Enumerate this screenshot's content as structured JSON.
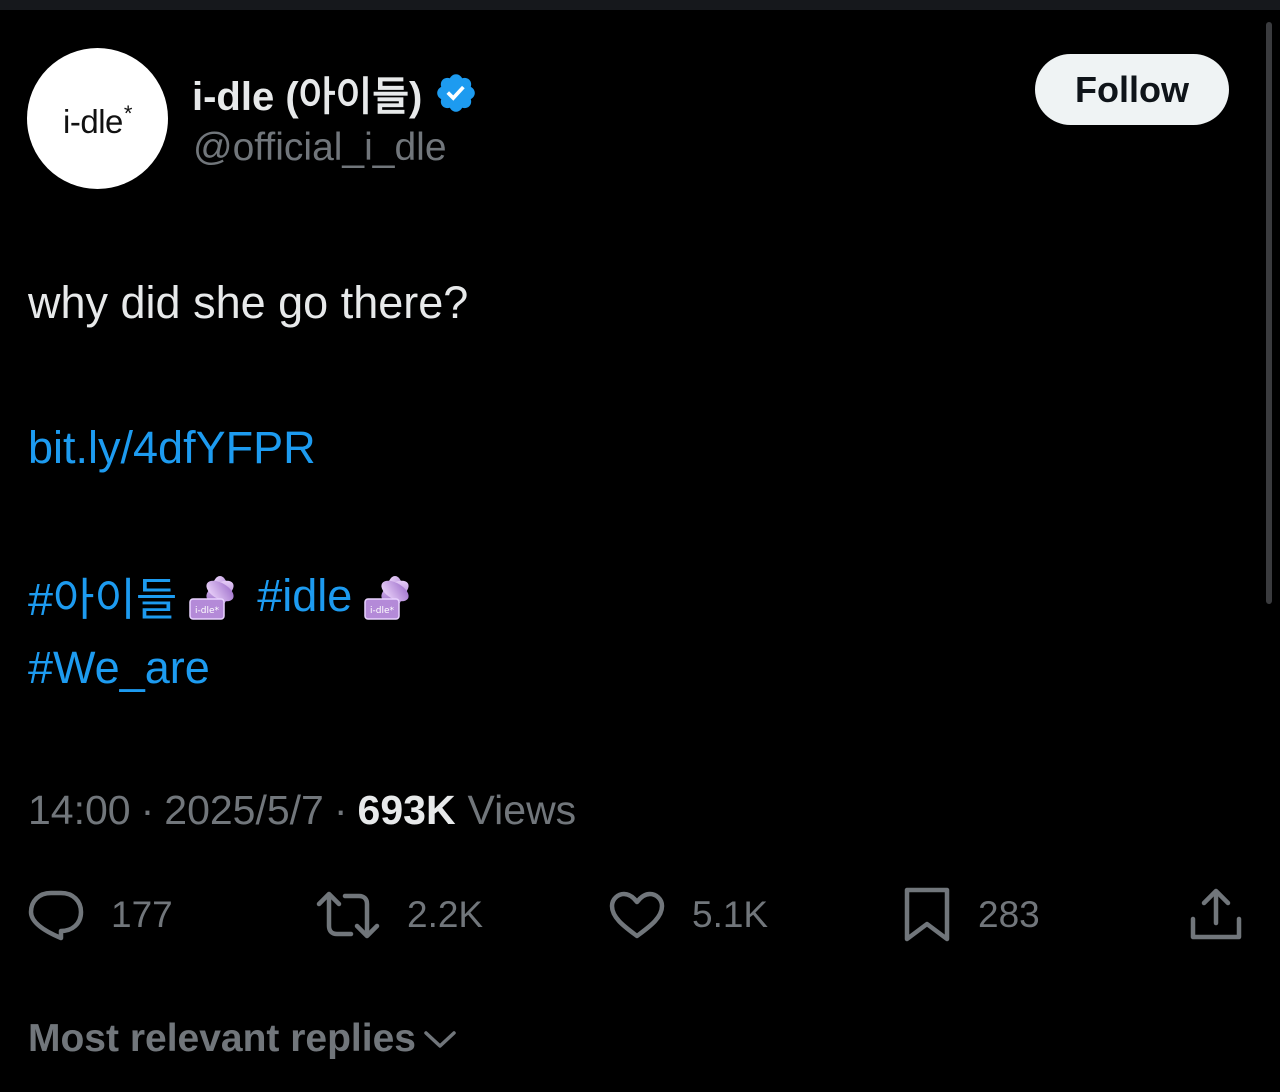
{
  "account": {
    "avatar_text": "i-dle",
    "avatar_mark": "*",
    "display_name": "i-dle (아이들)",
    "handle": "@official_i_dle",
    "verified_icon": "verified-badge-icon",
    "follow_label": "Follow"
  },
  "tweet": {
    "text": "why did she go there?",
    "link": "bit.ly/4dfYFPR",
    "hashtags": [
      "#아이들",
      "#idle",
      "#We_are"
    ],
    "emoji_icon": "idle-logo-emoji"
  },
  "meta": {
    "time": "14:00",
    "separator": "·",
    "date": "2025/5/7",
    "views_count": "693K",
    "views_label": "Views"
  },
  "actions": {
    "replies": "177",
    "retweets": "2.2K",
    "likes": "5.1K",
    "bookmarks": "283"
  },
  "replies_sort": {
    "label": "Most relevant replies"
  },
  "colors": {
    "background": "#000000",
    "primary_text": "#e7e9ea",
    "secondary_text": "#71767b",
    "accent": "#1d9bf0",
    "follow_bg": "#eff3f4"
  }
}
